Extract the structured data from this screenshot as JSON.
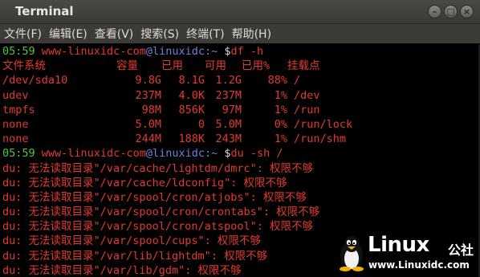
{
  "window": {
    "title": "Terminal"
  },
  "menu": [
    "文件(F)",
    "编辑(E)",
    "查看(V)",
    "搜索(S)",
    "终端(T)",
    "帮助(H)"
  ],
  "prompt1": {
    "time": "05:59",
    "host": "www-linuxidc-com",
    "user": "@linuxidc",
    "path": ":~",
    "sign": " $",
    "cmd": "df -h"
  },
  "df": {
    "header": [
      "文件系统",
      "容量",
      "已用",
      "可用",
      "已用%",
      "挂载点"
    ],
    "rows": [
      [
        "/dev/sda10",
        "9.8G",
        "8.1G",
        "1.2G",
        "88%",
        "/"
      ],
      [
        "udev",
        "237M",
        "4.0K",
        "237M",
        "1%",
        "/dev"
      ],
      [
        "tmpfs",
        "98M",
        "856K",
        "97M",
        "1%",
        "/run"
      ],
      [
        "none",
        "5.0M",
        "0",
        "5.0M",
        "0%",
        "/run/lock"
      ],
      [
        "none",
        "244M",
        "188K",
        "243M",
        "1%",
        "/run/shm"
      ]
    ]
  },
  "prompt2": {
    "time": "05:59",
    "host": "www-linuxidc-com",
    "user": "@linuxidc",
    "path": ":~",
    "sign": " $",
    "cmd": "du -sh /"
  },
  "du_errors": [
    "du: 无法读取目录\"/var/cache/lightdm/dmrc\": 权限不够",
    "du: 无法读取目录\"/var/cache/ldconfig\": 权限不够",
    "du: 无法读取目录\"/var/spool/cron/atjobs\": 权限不够",
    "du: 无法读取目录\"/var/spool/cron/crontabs\": 权限不够",
    "du: 无法读取目录\"/var/spool/cron/atspool\": 权限不够",
    "du: 无法读取目录\"/var/spool/cups\": 权限不够",
    "du: 无法读取目录\"/var/lib/lightdm\": 权限不够",
    "du: 无法读取目录\"/var/lib/gdm\": 权限不够"
  ],
  "watermark": {
    "brand": "Linux",
    "cn": "公社",
    "url": "www.Linuxidc.com"
  },
  "colors": {
    "prompt_time": "#4ec83a",
    "prompt_host": "#e23a2f",
    "prompt_user": "#6f7fd9",
    "output": "#e23a2f"
  }
}
